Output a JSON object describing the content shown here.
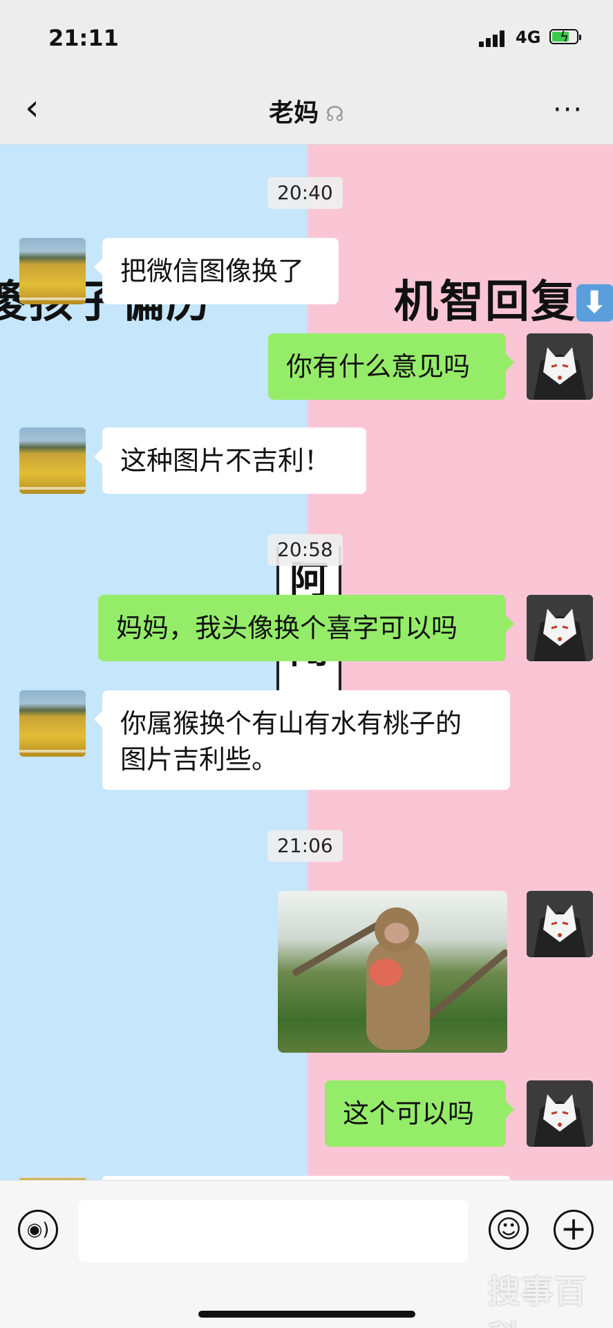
{
  "status_bar": {
    "time": "21:11",
    "network": "4G"
  },
  "header": {
    "back_label": "‹",
    "title": "老妈",
    "more_label": "···"
  },
  "overlay_text": {
    "left": "傻孩子偏历",
    "right": "机智回复",
    "right_arrow": "⬇",
    "vertical_top": "阿",
    "vertical_bottom": "闯"
  },
  "messages": {
    "ts1": "20:40",
    "m1": "把微信图像换了",
    "m2": "你有什么意见吗",
    "m3": "这种图片不吉利！",
    "ts2": "20:58",
    "m4": "妈妈，我头像换个喜字可以吗",
    "m5_line1": "你属猴换个有山有水有桃子的",
    "m5_line2": "图片吉利些。",
    "ts3": "21:06",
    "m7": "这个可以吗"
  },
  "input": {
    "placeholder": ""
  },
  "watermark": "搜事百科",
  "colors": {
    "left_bg": "#c5e6fb",
    "right_bg": "#fac6d6",
    "outgoing_bubble": "#95ec69",
    "incoming_bubble": "#ffffff"
  }
}
